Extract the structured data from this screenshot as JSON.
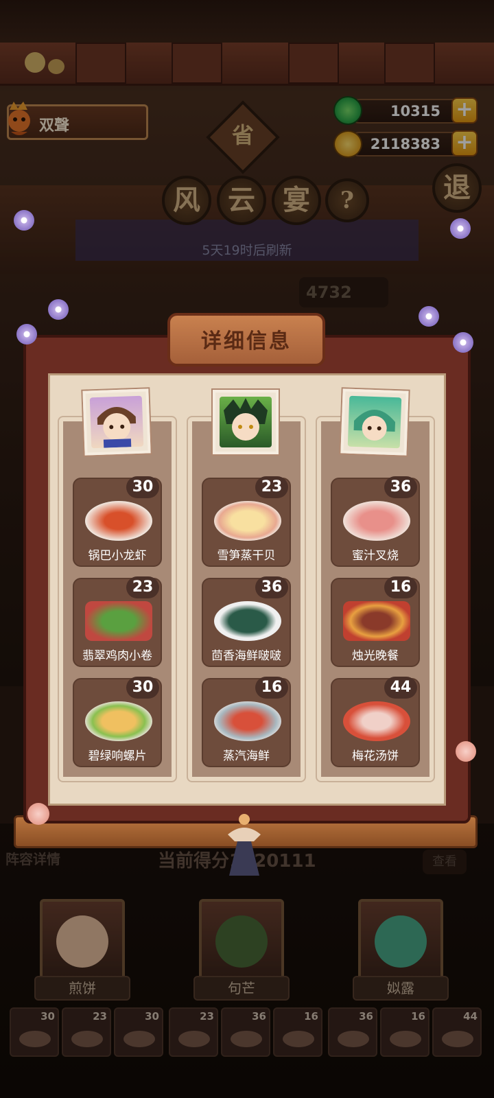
{
  "header": {
    "player_name": "双聲",
    "jade": "10315",
    "gold": "2118383",
    "plus": "+",
    "province_badge": "省",
    "event_title": [
      "风",
      "云",
      "宴"
    ],
    "help": "?",
    "exit": "退",
    "refresh_text": "5天19时后刷新",
    "partial_score": "4732"
  },
  "panel": {
    "title": "详细信息",
    "columns": [
      {
        "dishes": [
          {
            "name": "锅巴小龙虾",
            "count": "30"
          },
          {
            "name": "翡翠鸡肉小卷",
            "count": "23"
          },
          {
            "name": "碧绿响螺片",
            "count": "30"
          }
        ]
      },
      {
        "dishes": [
          {
            "name": "雪笋蒸干贝",
            "count": "23"
          },
          {
            "name": "茴香海鲜啵啵",
            "count": "36"
          },
          {
            "name": "蒸汽海鲜",
            "count": "16"
          }
        ]
      },
      {
        "dishes": [
          {
            "name": "蜜汁叉烧",
            "count": "36"
          },
          {
            "name": "烛光晚餐",
            "count": "16"
          },
          {
            "name": "梅花汤饼",
            "count": "44"
          }
        ]
      }
    ]
  },
  "lineup": {
    "label": "阵容详情",
    "score_text": "当前得分",
    "score_value": "1420111",
    "right_label": "查看",
    "characters": [
      {
        "name": "煎饼"
      },
      {
        "name": "句芒"
      },
      {
        "name": "姒露"
      }
    ],
    "mini_dishes": [
      "30",
      "23",
      "30",
      "23",
      "36",
      "16",
      "36",
      "16",
      "44"
    ]
  },
  "colors": {
    "panel_frame": "#6a2c22",
    "panel_paper": "#e8d8c2",
    "badge_gold": "#ffd24a",
    "jade_green": "#2ea84a"
  }
}
